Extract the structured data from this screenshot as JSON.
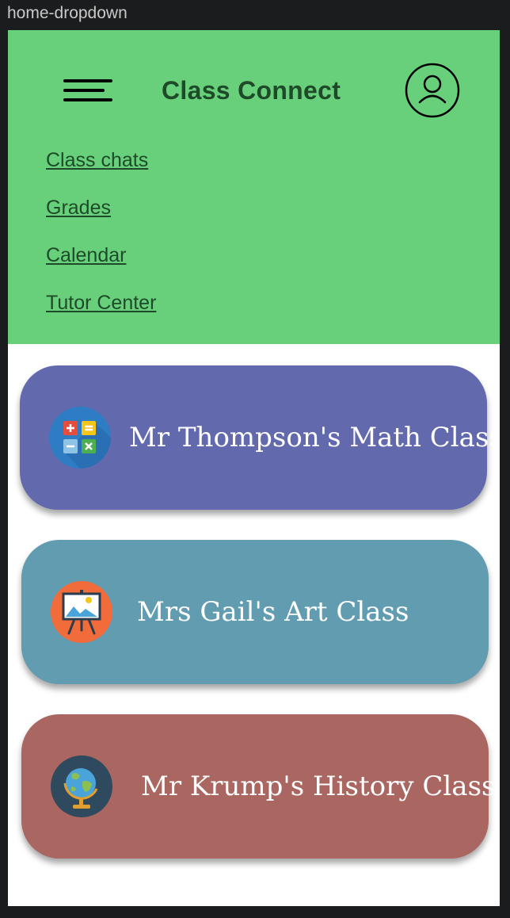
{
  "window": {
    "title": "home-dropdown"
  },
  "header": {
    "app_title": "Class Connect",
    "menu_icon": "hamburger-menu-icon",
    "profile_icon": "user-profile-icon",
    "background": "#68d07b"
  },
  "menu": {
    "items": [
      {
        "label": "Class chats"
      },
      {
        "label": "Grades"
      },
      {
        "label": "Calendar"
      },
      {
        "label": "Tutor Center"
      }
    ]
  },
  "classes": [
    {
      "name": "Mr Thompson's Math Class",
      "color": "#6269ad",
      "icon": "calculator-icon"
    },
    {
      "name": "Mrs Gail's Art Class",
      "color": "#619cb0",
      "icon": "easel-icon"
    },
    {
      "name": "Mr Krump's History Class",
      "color": "#aa6660",
      "icon": "globe-icon"
    }
  ]
}
